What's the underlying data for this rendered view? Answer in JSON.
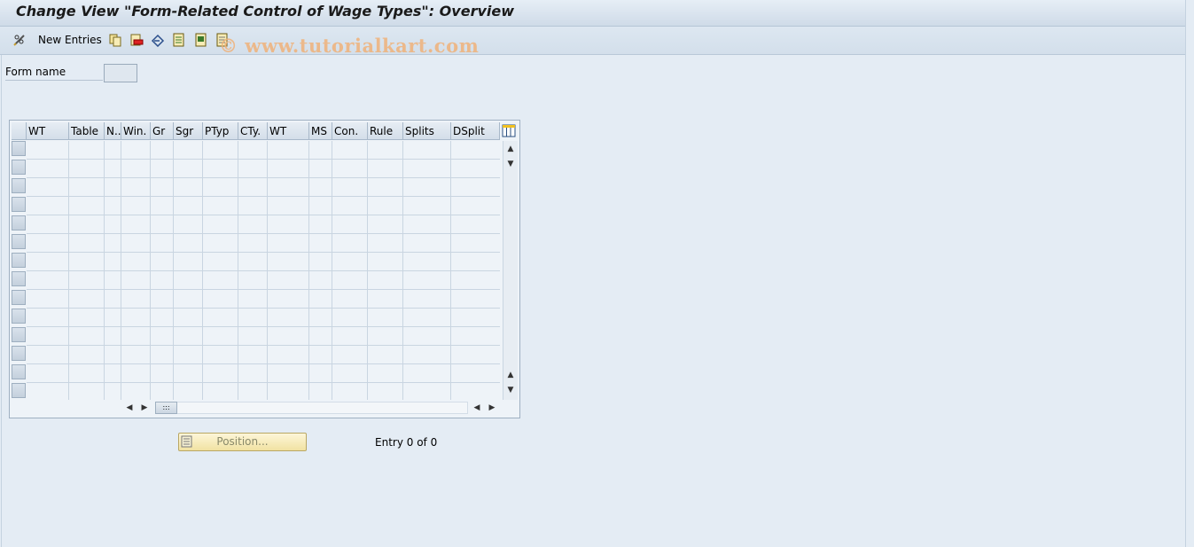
{
  "window": {
    "title": "Change View \"Form-Related Control of Wage Types\": Overview"
  },
  "toolbar": {
    "new_entries_label": "New Entries",
    "icons": [
      "edit-toggle-icon",
      "copy-icon",
      "delete-icon",
      "undo-icon",
      "select-all-icon",
      "select-block-icon",
      "deselect-all-icon"
    ]
  },
  "watermark": "© www.tutorialkart.com",
  "form": {
    "form_name_label": "Form name",
    "form_name_value": ""
  },
  "table": {
    "columns": [
      "WT",
      "Table",
      "N..",
      "Win.",
      "Gr",
      "Sgr",
      "PTyp",
      "CTy.",
      "WT",
      "MS",
      "Con.",
      "Rule",
      "Splits",
      "DSplit"
    ],
    "rows": []
  },
  "footer": {
    "position_label": "Position...",
    "entry_text": "Entry 0 of 0"
  },
  "colors": {
    "background": "#e4ecf4",
    "button": "#f1e2a2"
  }
}
